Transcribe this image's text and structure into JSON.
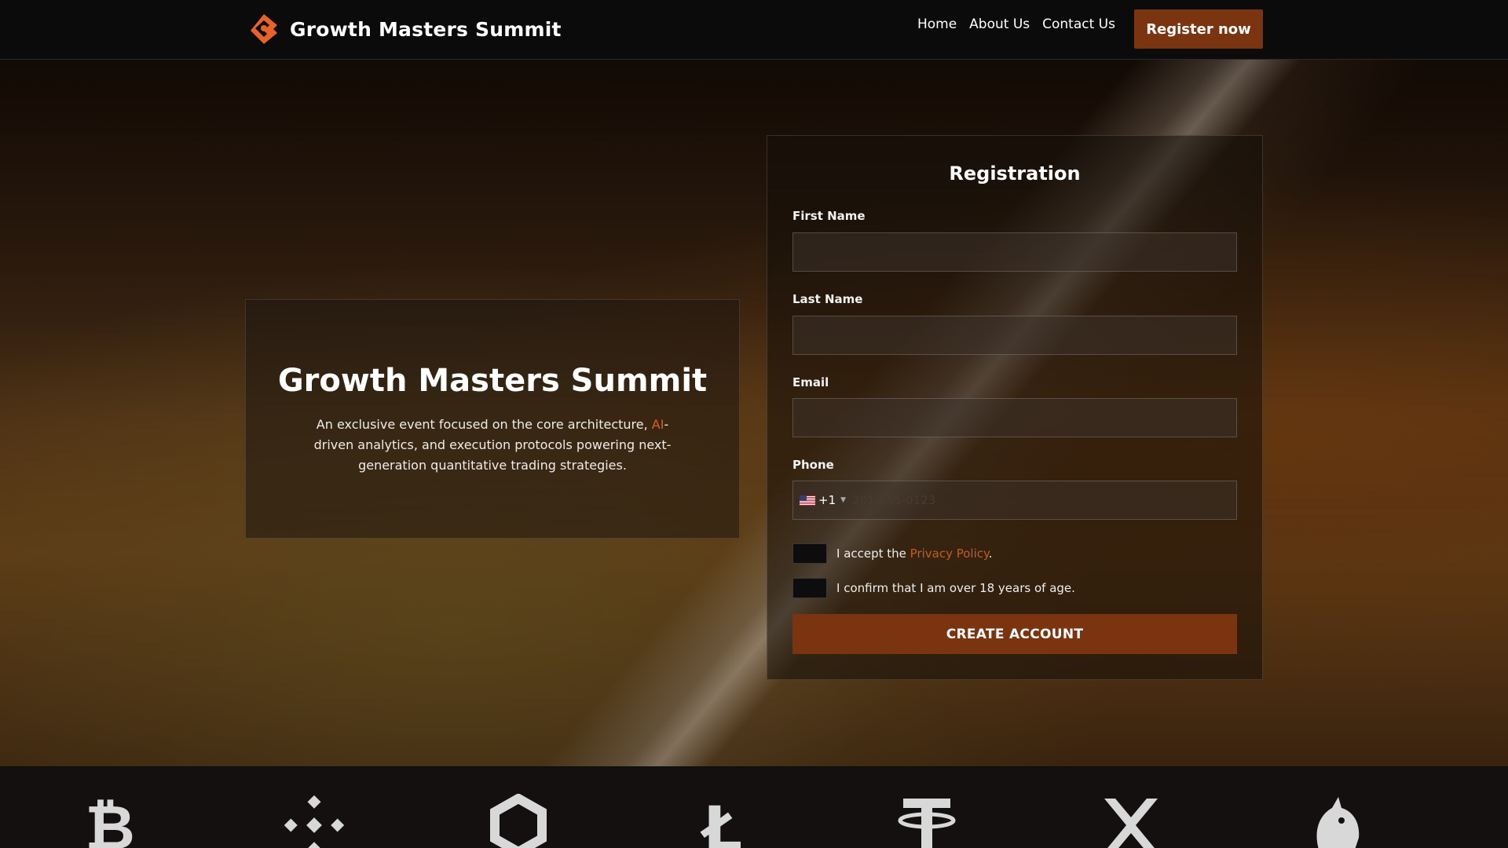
{
  "header": {
    "brand_name": "Growth Masters Summit",
    "nav": [
      {
        "label": "Home"
      },
      {
        "label": "About Us"
      },
      {
        "label": "Contact Us"
      }
    ],
    "register_label": "Register now"
  },
  "intro": {
    "title": "Growth Masters Summit",
    "text_before": "An exclusive event focused on the core architecture, ",
    "highlight": "AI",
    "text_after": "-driven analytics, and execution protocols powering next-generation quantitative trading strategies."
  },
  "registration": {
    "title": "Registration",
    "first_name_label": "First Name",
    "first_name_value": "",
    "last_name_label": "Last Name",
    "last_name_value": "",
    "email_label": "Email",
    "email_value": "",
    "phone_label": "Phone",
    "phone_dial_code": "+1",
    "phone_placeholder": "201-555-0123",
    "phone_country": "us-flag-icon",
    "privacy_prefix": "I accept the ",
    "privacy_link": "Privacy Policy",
    "privacy_suffix": ".",
    "age_confirm": "I confirm that I am over 18 years of age.",
    "submit_label": "CREATE ACCOUNT"
  },
  "crypto_logos": [
    {
      "icon": "bitcoin-icon"
    },
    {
      "icon": "binance-icon"
    },
    {
      "icon": "chainlink-icon"
    },
    {
      "icon": "litecoin-icon"
    },
    {
      "icon": "tether-icon"
    },
    {
      "icon": "xrp-icon"
    },
    {
      "icon": "uniswap-icon"
    }
  ],
  "colors": {
    "accent": "#7a3410",
    "link": "#c55a22",
    "highlight": "#d9601e",
    "header_bg": "#0b0b0b",
    "logos_bg": "#151010"
  }
}
